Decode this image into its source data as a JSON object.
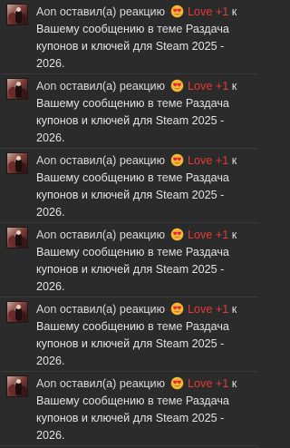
{
  "alerts": [
    {
      "user": "Aon",
      "action": "оставил(а) реакцию",
      "reaction_icon": "heart-eyes-emoji",
      "reaction_label": "Love +1",
      "connector": "к",
      "link_text": "Вашему сообщению",
      "context_prefix": "в теме",
      "thread_title": "Раздача купонов и ключей для Steam 2025 - 2026."
    },
    {
      "user": "Aon",
      "action": "оставил(а) реакцию",
      "reaction_icon": "heart-eyes-emoji",
      "reaction_label": "Love +1",
      "connector": "к",
      "link_text": "Вашему сообщению",
      "context_prefix": "в теме",
      "thread_title": "Раздача купонов и ключей для Steam 2025 - 2026."
    },
    {
      "user": "Aon",
      "action": "оставил(а) реакцию",
      "reaction_icon": "heart-eyes-emoji",
      "reaction_label": "Love +1",
      "connector": "к",
      "link_text": "Вашему сообщению",
      "context_prefix": "в теме",
      "thread_title": "Раздача купонов и ключей для Steam 2025 - 2026."
    },
    {
      "user": "Aon",
      "action": "оставил(а) реакцию",
      "reaction_icon": "heart-eyes-emoji",
      "reaction_label": "Love +1",
      "connector": "к",
      "link_text": "Вашему сообщению",
      "context_prefix": "в теме",
      "thread_title": "Раздача купонов и ключей для Steam 2025 - 2026."
    },
    {
      "user": "Aon",
      "action": "оставил(а) реакцию",
      "reaction_icon": "heart-eyes-emoji",
      "reaction_label": "Love +1",
      "connector": "к",
      "link_text": "Вашему сообщению",
      "context_prefix": "в теме",
      "thread_title": "Раздача купонов и ключей для Steam 2025 - 2026."
    },
    {
      "user": "Aon",
      "action": "оставил(а) реакцию",
      "reaction_icon": "heart-eyes-emoji",
      "reaction_label": "Love +1",
      "connector": "к",
      "link_text": "Вашему сообщению",
      "context_prefix": "в теме",
      "thread_title": "Раздача купонов и ключей для Steam 2025 - 2026."
    }
  ],
  "colors": {
    "background": "#2b2b2b",
    "text": "#dcdcdc",
    "reaction_label": "#e53935",
    "divider": "#3a3a3a"
  }
}
